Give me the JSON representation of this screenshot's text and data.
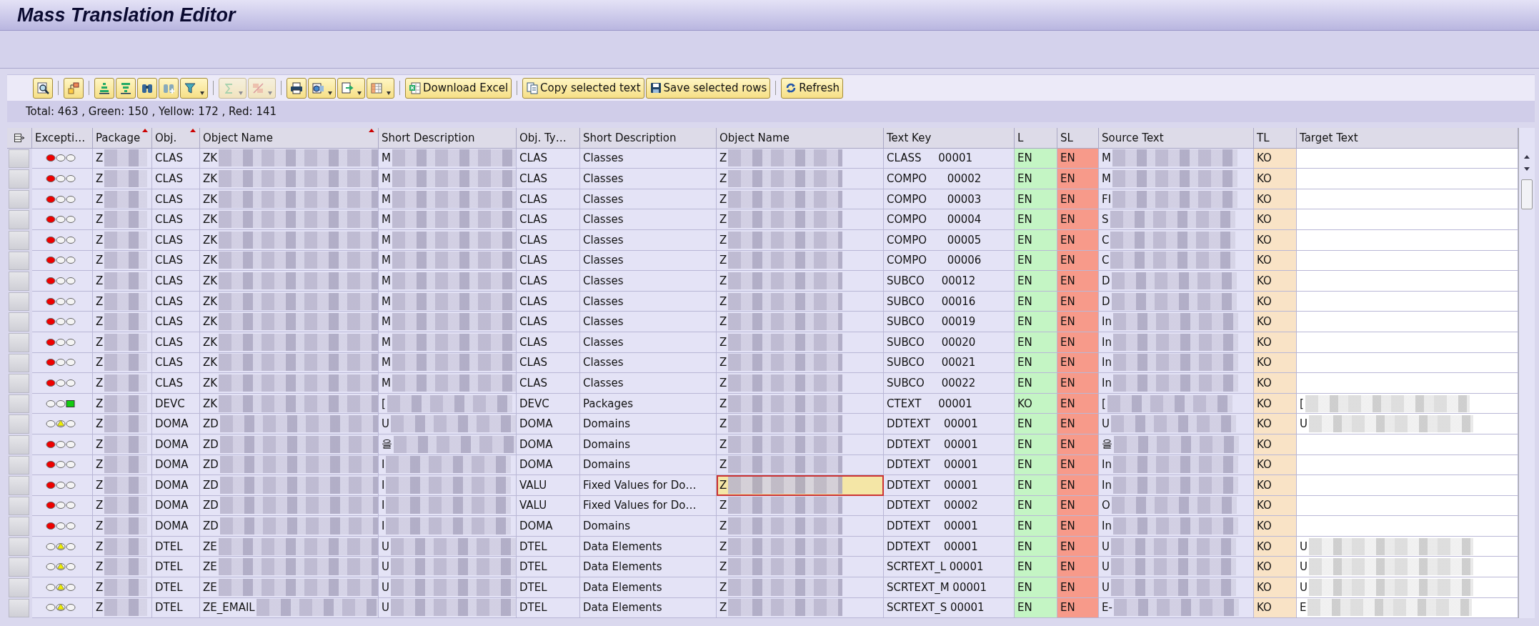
{
  "window": {
    "title": "Mass Translation Editor"
  },
  "toolbar": [
    {
      "kind": "icon",
      "menu": false,
      "disabled": false
    },
    {
      "kind": "separator"
    },
    {
      "kind": "icon",
      "menu": false,
      "disabled": false
    },
    {
      "kind": "separator"
    },
    {
      "kind": "icon",
      "menu": false,
      "disabled": false
    },
    {
      "kind": "icon",
      "menu": false,
      "disabled": false
    },
    {
      "kind": "icon",
      "menu": false,
      "disabled": false
    },
    {
      "kind": "icon",
      "menu": false,
      "disabled": false
    },
    {
      "kind": "icon",
      "menu": true,
      "disabled": false
    },
    {
      "kind": "separator"
    },
    {
      "kind": "icon",
      "menu": true,
      "disabled": true
    },
    {
      "kind": "icon",
      "menu": true,
      "disabled": true
    },
    {
      "kind": "separator"
    },
    {
      "kind": "icon",
      "menu": false,
      "disabled": false
    },
    {
      "kind": "icon",
      "menu": true,
      "disabled": false
    },
    {
      "kind": "icon",
      "menu": true,
      "disabled": false
    },
    {
      "kind": "icon",
      "menu": true,
      "disabled": false
    },
    {
      "kind": "separator"
    },
    {
      "kind": "text",
      "label": "Download Excel",
      "menu": false,
      "disabled": false
    },
    {
      "kind": "separator"
    },
    {
      "kind": "text",
      "label": "Copy selected text",
      "menu": false,
      "disabled": false
    },
    {
      "kind": "text",
      "label": "Save selected rows",
      "menu": false,
      "disabled": false
    },
    {
      "kind": "separator"
    },
    {
      "kind": "text",
      "label": "Refresh",
      "menu": false,
      "disabled": false
    }
  ],
  "summary": "Total: 463 , Green: 150 , Yellow: 172 , Red: 141",
  "table": {
    "columns": [
      {
        "label": "Excepti…",
        "kind": "exception",
        "sorted": false
      },
      {
        "label": "Package",
        "kind": "masked",
        "sorted": true
      },
      {
        "label": "Obj.",
        "kind": "plain",
        "sorted": true
      },
      {
        "label": "Object Name",
        "kind": "masked",
        "sorted": true
      },
      {
        "label": "Short Description",
        "kind": "masked",
        "sorted": false
      },
      {
        "label": "Obj. Ty…",
        "kind": "plain",
        "sorted": false
      },
      {
        "label": "Short Description",
        "kind": "plain",
        "sorted": false
      },
      {
        "label": "Object Name",
        "kind": "masked",
        "sorted": false
      },
      {
        "label": "Text Key",
        "kind": "plain",
        "sorted": false
      },
      {
        "label": "L",
        "kind": "language",
        "color": "#c4f5c4",
        "sorted": false
      },
      {
        "label": "SL",
        "kind": "language",
        "color": "#f79a8a",
        "sorted": false
      },
      {
        "label": "Source Text",
        "kind": "masked",
        "sorted": false
      },
      {
        "label": "TL",
        "kind": "language",
        "color": "#f9e3c6",
        "sorted": false
      },
      {
        "label": "Target Text",
        "kind": "target",
        "sorted": false
      }
    ],
    "rows": [
      {
        "kind": "red",
        "focused": false,
        "cells": [
          "",
          "Z",
          "CLAS",
          "ZK",
          "M",
          "CLAS",
          "Classes",
          "Z",
          "CLASS     00001",
          "EN",
          "EN",
          "M",
          "KO",
          null
        ]
      },
      {
        "kind": "red",
        "focused": false,
        "cells": [
          "",
          "Z",
          "CLAS",
          "ZK",
          "M",
          "CLAS",
          "Classes",
          "Z",
          "COMPO      00002",
          "EN",
          "EN",
          "M",
          "KO",
          null
        ]
      },
      {
        "kind": "red",
        "focused": false,
        "cells": [
          "",
          "Z",
          "CLAS",
          "ZK",
          "M",
          "CLAS",
          "Classes",
          "Z",
          "COMPO      00003",
          "EN",
          "EN",
          "FI",
          "KO",
          null
        ]
      },
      {
        "kind": "red",
        "focused": false,
        "cells": [
          "",
          "Z",
          "CLAS",
          "ZK",
          "M",
          "CLAS",
          "Classes",
          "Z",
          "COMPO      00004",
          "EN",
          "EN",
          "S",
          "KO",
          null
        ]
      },
      {
        "kind": "red",
        "focused": false,
        "cells": [
          "",
          "Z",
          "CLAS",
          "ZK",
          "M",
          "CLAS",
          "Classes",
          "Z",
          "COMPO      00005",
          "EN",
          "EN",
          "C",
          "KO",
          null
        ]
      },
      {
        "kind": "red",
        "focused": false,
        "cells": [
          "",
          "Z",
          "CLAS",
          "ZK",
          "M",
          "CLAS",
          "Classes",
          "Z",
          "COMPO      00006",
          "EN",
          "EN",
          "C",
          "KO",
          null
        ]
      },
      {
        "kind": "red",
        "focused": false,
        "cells": [
          "",
          "Z",
          "CLAS",
          "ZK",
          "M",
          "CLAS",
          "Classes",
          "Z",
          "SUBCO     00012",
          "EN",
          "EN",
          "D",
          "KO",
          null
        ]
      },
      {
        "kind": "red",
        "focused": false,
        "cells": [
          "",
          "Z",
          "CLAS",
          "ZK",
          "M",
          "CLAS",
          "Classes",
          "Z",
          "SUBCO     00016",
          "EN",
          "EN",
          "D",
          "KO",
          null
        ]
      },
      {
        "kind": "red",
        "focused": false,
        "cells": [
          "",
          "Z",
          "CLAS",
          "ZK",
          "M",
          "CLAS",
          "Classes",
          "Z",
          "SUBCO     00019",
          "EN",
          "EN",
          "In",
          "KO",
          null
        ]
      },
      {
        "kind": "red",
        "focused": false,
        "cells": [
          "",
          "Z",
          "CLAS",
          "ZK",
          "M",
          "CLAS",
          "Classes",
          "Z",
          "SUBCO     00020",
          "EN",
          "EN",
          "In",
          "KO",
          null
        ]
      },
      {
        "kind": "red",
        "focused": false,
        "cells": [
          "",
          "Z",
          "CLAS",
          "ZK",
          "M",
          "CLAS",
          "Classes",
          "Z",
          "SUBCO     00021",
          "EN",
          "EN",
          "In",
          "KO",
          null
        ]
      },
      {
        "kind": "red",
        "focused": false,
        "cells": [
          "",
          "Z",
          "CLAS",
          "ZK",
          "M",
          "CLAS",
          "Classes",
          "Z",
          "SUBCO     00022",
          "EN",
          "EN",
          "In",
          "KO",
          null
        ]
      },
      {
        "kind": "green",
        "focused": false,
        "cells": [
          "",
          "Z",
          "DEVC",
          "ZK",
          "[",
          "DEVC",
          "Packages",
          "Z",
          "CTEXT     00001",
          "KO",
          "EN",
          "[",
          "KO",
          "["
        ]
      },
      {
        "kind": "yellow",
        "focused": false,
        "cells": [
          "",
          "Z",
          "DOMA",
          "ZD",
          "U",
          "DOMA",
          "Domains",
          "Z",
          "DDTEXT    00001",
          "EN",
          "EN",
          "U",
          "KO",
          "U"
        ]
      },
      {
        "kind": "red",
        "focused": false,
        "cells": [
          "",
          "Z",
          "DOMA",
          "ZD",
          "을",
          "DOMA",
          "Domains",
          "Z",
          "DDTEXT    00001",
          "EN",
          "EN",
          "을",
          "KO",
          null
        ]
      },
      {
        "kind": "red",
        "focused": false,
        "cells": [
          "",
          "Z",
          "DOMA",
          "ZD",
          "I",
          "DOMA",
          "Domains",
          "Z",
          "DDTEXT    00001",
          "EN",
          "EN",
          "In",
          "KO",
          null
        ]
      },
      {
        "kind": "red",
        "focused": true,
        "cells": [
          "",
          "Z",
          "DOMA",
          "ZD",
          "I",
          "VALU",
          "Fixed Values for Do…",
          "Z",
          "DDTEXT    00001",
          "EN",
          "EN",
          "In",
          "KO",
          null
        ]
      },
      {
        "kind": "red",
        "focused": false,
        "cells": [
          "",
          "Z",
          "DOMA",
          "ZD",
          "I",
          "VALU",
          "Fixed Values for Do…",
          "Z",
          "DDTEXT    00002",
          "EN",
          "EN",
          "O",
          "KO",
          null
        ]
      },
      {
        "kind": "red",
        "focused": false,
        "cells": [
          "",
          "Z",
          "DOMA",
          "ZD",
          "I",
          "DOMA",
          "Domains",
          "Z",
          "DDTEXT    00001",
          "EN",
          "EN",
          "In",
          "KO",
          null
        ]
      },
      {
        "kind": "yellow",
        "focused": false,
        "cells": [
          "",
          "Z",
          "DTEL",
          "ZE",
          "U",
          "DTEL",
          "Data Elements",
          "Z",
          "DDTEXT    00001",
          "EN",
          "EN",
          "U",
          "KO",
          "U"
        ]
      },
      {
        "kind": "yellow",
        "focused": false,
        "cells": [
          "",
          "Z",
          "DTEL",
          "ZE",
          "U",
          "DTEL",
          "Data Elements",
          "Z",
          "SCRTEXT_L 00001",
          "EN",
          "EN",
          "U",
          "KO",
          "U"
        ]
      },
      {
        "kind": "yellow",
        "focused": false,
        "cells": [
          "",
          "Z",
          "DTEL",
          "ZE",
          "U",
          "DTEL",
          "Data Elements",
          "Z",
          "SCRTEXT_M 00001",
          "EN",
          "EN",
          "U",
          "KO",
          "U"
        ]
      },
      {
        "kind": "yellow",
        "focused": false,
        "cells": [
          "",
          "Z",
          "DTEL",
          "ZE_EMAIL",
          "U",
          "DTEL",
          "Data Elements",
          "Z",
          "SCRTEXT_S 00001",
          "EN",
          "EN",
          "E-",
          "KO",
          "E"
        ]
      }
    ]
  }
}
